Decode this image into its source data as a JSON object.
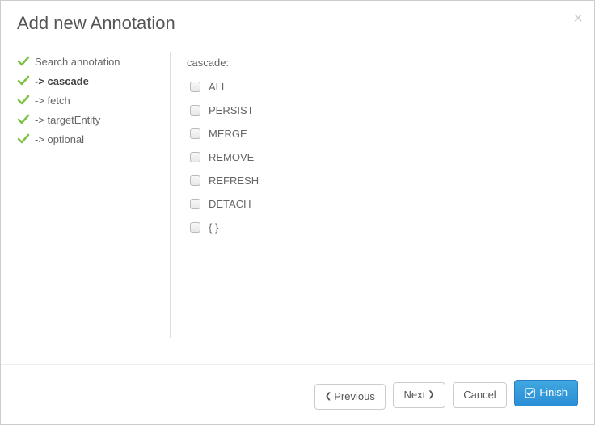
{
  "title": "Add new Annotation",
  "sidebar": {
    "items": [
      {
        "label": "Search annotation",
        "active": false
      },
      {
        "label": "-> cascade",
        "active": true
      },
      {
        "label": "-> fetch",
        "active": false
      },
      {
        "label": "-> targetEntity",
        "active": false
      },
      {
        "label": "-> optional",
        "active": false
      }
    ]
  },
  "content": {
    "label": "cascade:",
    "options": [
      "ALL",
      "PERSIST",
      "MERGE",
      "REMOVE",
      "REFRESH",
      "DETACH",
      "{ }"
    ]
  },
  "footer": {
    "previous": "Previous",
    "next": "Next",
    "cancel": "Cancel",
    "finish": "Finish"
  }
}
